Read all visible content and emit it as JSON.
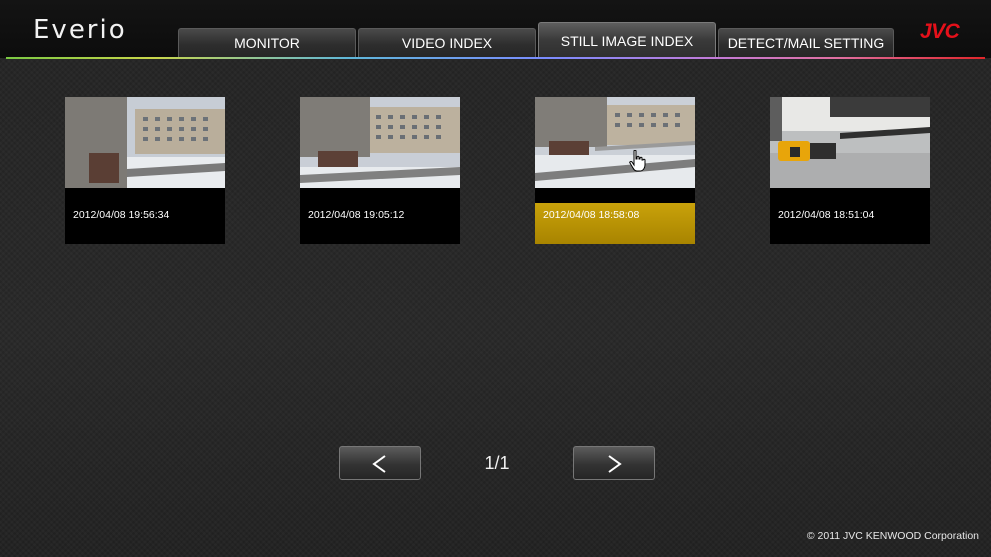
{
  "app": {
    "brand": "Everio",
    "logo": "JVC"
  },
  "tabs": [
    {
      "label": "MONITOR",
      "active": false
    },
    {
      "label": "VIDEO INDEX",
      "active": false
    },
    {
      "label": "STILL IMAGE INDEX",
      "active": true
    },
    {
      "label": "DETECT/MAIL SETTING",
      "active": false
    }
  ],
  "images": [
    {
      "timestamp": "2012/04/08 19:56:34",
      "selected": false
    },
    {
      "timestamp": "2012/04/08 19:05:12",
      "selected": false
    },
    {
      "timestamp": "2012/04/08 18:58:08",
      "selected": true
    },
    {
      "timestamp": "2012/04/08 18:51:04",
      "selected": false
    }
  ],
  "pagination": {
    "prev_icon": "chevron-left-icon",
    "page_label": "1/1",
    "next_icon": "chevron-right-icon"
  },
  "footer": {
    "copyright": "© 2011 JVC KENWOOD Corporation"
  },
  "colors": {
    "accent_logo": "#e5101a",
    "selection": "#b89400"
  }
}
